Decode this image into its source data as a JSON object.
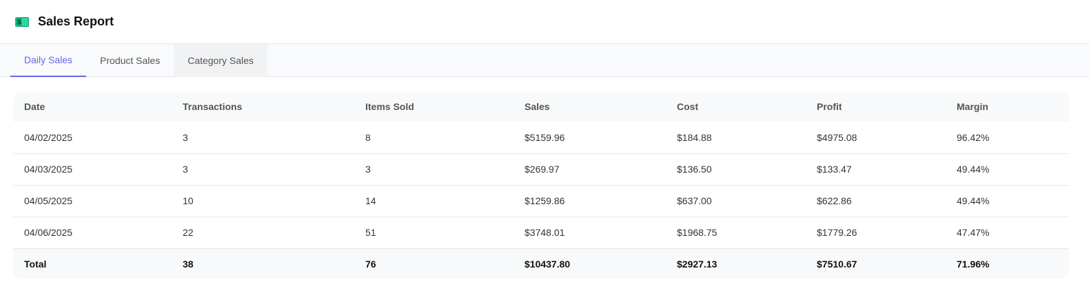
{
  "header": {
    "title": "Sales Report",
    "icon": "money-icon"
  },
  "tabs": [
    {
      "label": "Daily Sales",
      "active": true
    },
    {
      "label": "Product Sales",
      "active": false
    },
    {
      "label": "Category Sales",
      "active": false
    }
  ],
  "table": {
    "columns": [
      "Date",
      "Transactions",
      "Items Sold",
      "Sales",
      "Cost",
      "Profit",
      "Margin"
    ],
    "rows": [
      [
        "04/02/2025",
        "3",
        "8",
        "$5159.96",
        "$184.88",
        "$4975.08",
        "96.42%"
      ],
      [
        "04/03/2025",
        "3",
        "3",
        "$269.97",
        "$136.50",
        "$133.47",
        "49.44%"
      ],
      [
        "04/05/2025",
        "10",
        "14",
        "$1259.86",
        "$637.00",
        "$622.86",
        "49.44%"
      ],
      [
        "04/06/2025",
        "22",
        "51",
        "$3748.01",
        "$1968.75",
        "$1779.26",
        "47.47%"
      ]
    ],
    "total": [
      "Total",
      "38",
      "76",
      "$10437.80",
      "$2927.13",
      "$7510.67",
      "71.96%"
    ]
  },
  "colors": {
    "accent": "#6366f1",
    "icon_green": "#10b981"
  }
}
